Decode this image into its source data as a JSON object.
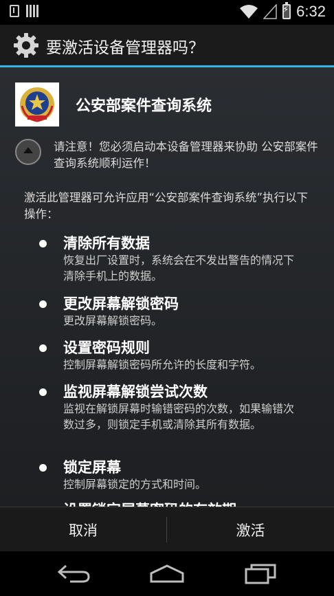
{
  "status_bar": {
    "time": "6:32",
    "left_icons": [
      "download-icon",
      "barcode-icon"
    ],
    "right_icons": [
      "wifi-icon",
      "signal-icon",
      "battery-charging-icon"
    ]
  },
  "title_bar": {
    "icon": "gear-icon",
    "title": "要激活设备管理器吗？"
  },
  "app": {
    "icon": "police-emblem-icon",
    "name": "公安部案件查询系统"
  },
  "warning": {
    "icon": "collapse-arrow-icon",
    "text": "请注意！您必须启动本设备管理器来协助 公安部案件查询系统顺利运作！"
  },
  "description": "激活此管理器可允许应用“公安部案件查询系统”执行以下操作：",
  "policies": [
    {
      "title": "清除所有数据",
      "desc": "恢复出厂设置时，系统会在不发出警告的情况下清除手机上的数据。"
    },
    {
      "title": "更改屏幕解锁密码",
      "desc": "更改屏幕解锁密码。"
    },
    {
      "title": "设置密码规则",
      "desc": "控制屏幕解锁密码所允许的长度和字符。"
    },
    {
      "title": "监视屏幕解锁尝试次数",
      "desc": "监视在解锁屏幕时输错密码的次数，如果输错次数过多，则锁定手机或清除其所有数据。"
    },
    {
      "title": "锁定屏幕",
      "desc": "控制屏幕锁定的方式和时间。"
    },
    {
      "title": "设置锁定屏幕密码的有效期",
      "desc": ""
    }
  ],
  "buttons": {
    "cancel": "取消",
    "activate": "激活"
  },
  "nav": {
    "back": "back-icon",
    "home": "home-icon",
    "recent": "recent-apps-icon"
  },
  "colors": {
    "accent": "#33b5e5",
    "background": "#000000",
    "content_bg": "#25282c"
  }
}
